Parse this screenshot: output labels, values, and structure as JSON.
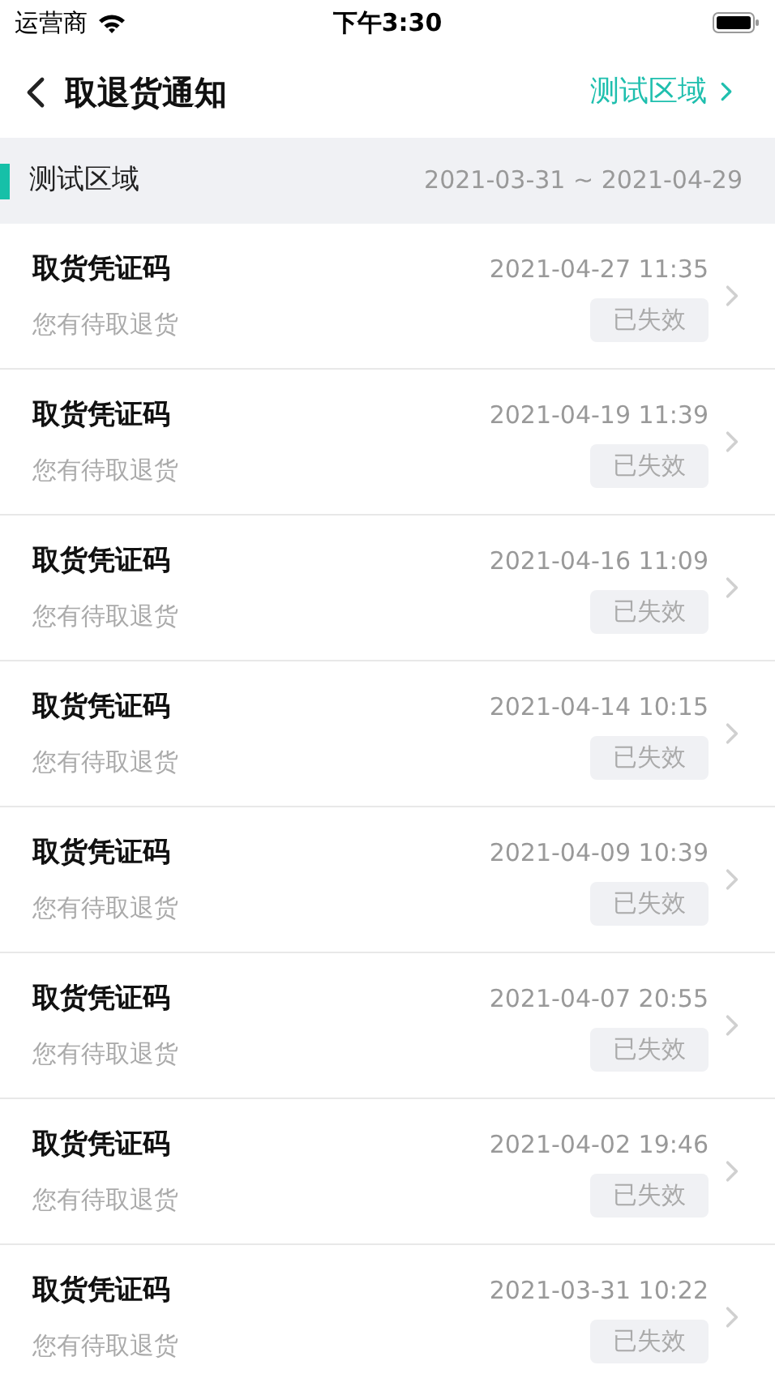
{
  "status_bar": {
    "carrier": "运营商",
    "time": "下午3:30"
  },
  "nav": {
    "title": "取退货通知",
    "region_link": "测试区域"
  },
  "section": {
    "title": "测试区域",
    "date_range": "2021-03-31 ~ 2021-04-29"
  },
  "notices": [
    {
      "title": "取货凭证码",
      "subtitle": "您有待取退货",
      "time": "2021-04-27 11:35",
      "status": "已失效"
    },
    {
      "title": "取货凭证码",
      "subtitle": "您有待取退货",
      "time": "2021-04-19 11:39",
      "status": "已失效"
    },
    {
      "title": "取货凭证码",
      "subtitle": "您有待取退货",
      "time": "2021-04-16 11:09",
      "status": "已失效"
    },
    {
      "title": "取货凭证码",
      "subtitle": "您有待取退货",
      "time": "2021-04-14 10:15",
      "status": "已失效"
    },
    {
      "title": "取货凭证码",
      "subtitle": "您有待取退货",
      "time": "2021-04-09 10:39",
      "status": "已失效"
    },
    {
      "title": "取货凭证码",
      "subtitle": "您有待取退货",
      "time": "2021-04-07 20:55",
      "status": "已失效"
    },
    {
      "title": "取货凭证码",
      "subtitle": "您有待取退货",
      "time": "2021-04-02 19:46",
      "status": "已失效"
    },
    {
      "title": "取货凭证码",
      "subtitle": "您有待取退货",
      "time": "2021-03-31 10:22",
      "status": "已失效"
    }
  ]
}
